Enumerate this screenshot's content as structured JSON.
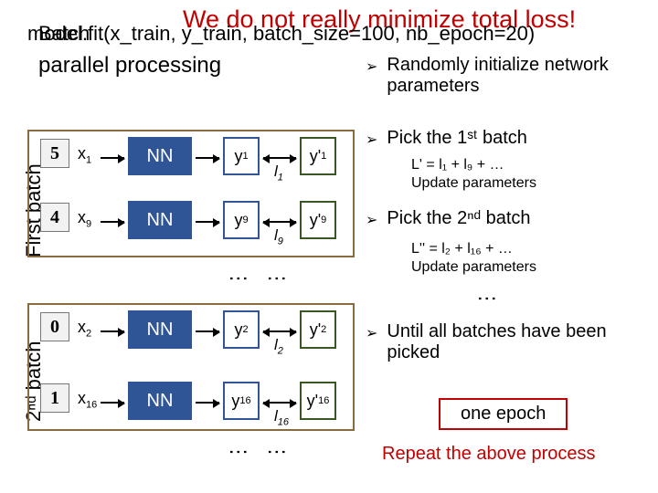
{
  "header": {
    "red_title": "We do not really minimize total loss!",
    "code": "model.fit(x_train, y_train, batch_size=100, nb_epoch=20)",
    "batch_overlay": "Batch",
    "parallel": "parallel processing"
  },
  "batches": {
    "label1": "First batch",
    "label2": "2ⁿᵈ batch"
  },
  "rows": {
    "r1": {
      "digit": "5",
      "x": "x",
      "xsub": "1",
      "nn": "NN",
      "y": "y",
      "ysub": "1",
      "yp": "y'",
      "ypsub": "1",
      "l": "l",
      "lsub": "1"
    },
    "r2": {
      "digit": "4",
      "x": "x",
      "xsub": "9",
      "nn": "NN",
      "y": "y",
      "ysub": "9",
      "yp": "y'",
      "ypsub": "9",
      "l": "l",
      "lsub": "9"
    },
    "r3": {
      "digit": "0",
      "x": "x",
      "xsub": "2",
      "nn": "NN",
      "y": "y",
      "ysub": "2",
      "yp": "y'",
      "ypsub": "2",
      "l": "l",
      "lsub": "2"
    },
    "r4": {
      "digit": "1",
      "x": "x",
      "xsub": "16",
      "nn": "NN",
      "y": "y",
      "ysub": "16",
      "yp": "y'",
      "ypsub": "16",
      "l": "l",
      "lsub": "16"
    }
  },
  "steps": {
    "s0": "Randomly initialize network parameters",
    "s1": "Pick the 1ˢᵗ batch",
    "s1note_a": "L' = l₁ + l₉ + …",
    "s1note_b": "Update parameters",
    "s2": "Pick the 2ⁿᵈ batch",
    "s2note_a": "L'' = l₂ + l₁₆ + …",
    "s2note_b": "Update parameters",
    "s3": "Until all batches have been picked",
    "epoch": "one epoch",
    "repeat": "Repeat the above process"
  },
  "glyphs": {
    "tri": "➢",
    "vdots": "⋮"
  }
}
